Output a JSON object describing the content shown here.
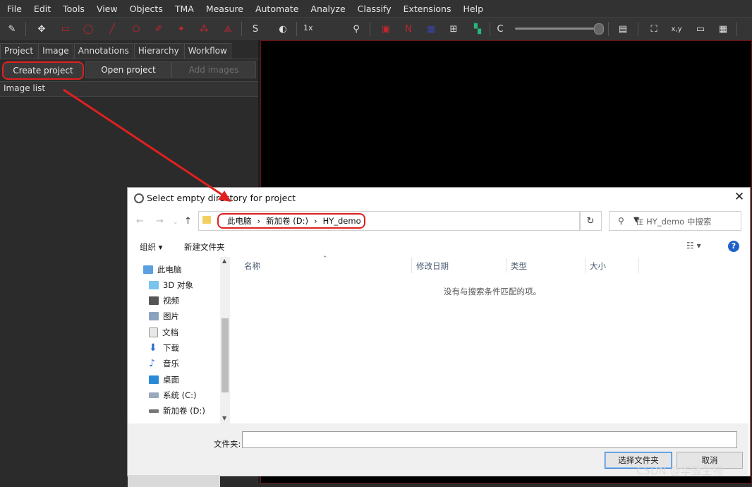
{
  "menu": [
    "File",
    "Edit",
    "Tools",
    "View",
    "Objects",
    "TMA",
    "Measure",
    "Automate",
    "Analyze",
    "Classify",
    "Extensions",
    "Help"
  ],
  "toolbar": {
    "zoom_label": "1x",
    "s_label": "S",
    "c_label": "C",
    "xy_label": "x,y"
  },
  "left_panel": {
    "tabs": [
      "Project",
      "Image",
      "Annotations",
      "Hierarchy",
      "Workflow"
    ],
    "create_project": "Create project",
    "open_project": "Open project",
    "add_images": "Add images",
    "image_list": "Image list"
  },
  "dialog": {
    "title": "Select empty directory for project",
    "breadcrumb": [
      "此电脑",
      "新加卷 (D:)",
      "HY_demo"
    ],
    "search_placeholder": "在 HY_demo 中搜索",
    "organize": "组织 ▾",
    "new_folder": "新建文件夹",
    "nav_tree": [
      "此电脑",
      "3D 对象",
      "视频",
      "图片",
      "文档",
      "下载",
      "音乐",
      "桌面",
      "系统 (C:)",
      "新加卷 (D:)"
    ],
    "columns": [
      "名称",
      "修改日期",
      "类型",
      "大小"
    ],
    "empty_message": "没有与搜索条件匹配的项。",
    "folder_label": "文件夹:",
    "folder_value": "",
    "select_button": "选择文件夹",
    "cancel_button": "取消"
  },
  "watermark": "CSDN @华盈生物",
  "colors": {
    "annotation_red": "#e02020",
    "accent_blue": "#1f62c8"
  }
}
